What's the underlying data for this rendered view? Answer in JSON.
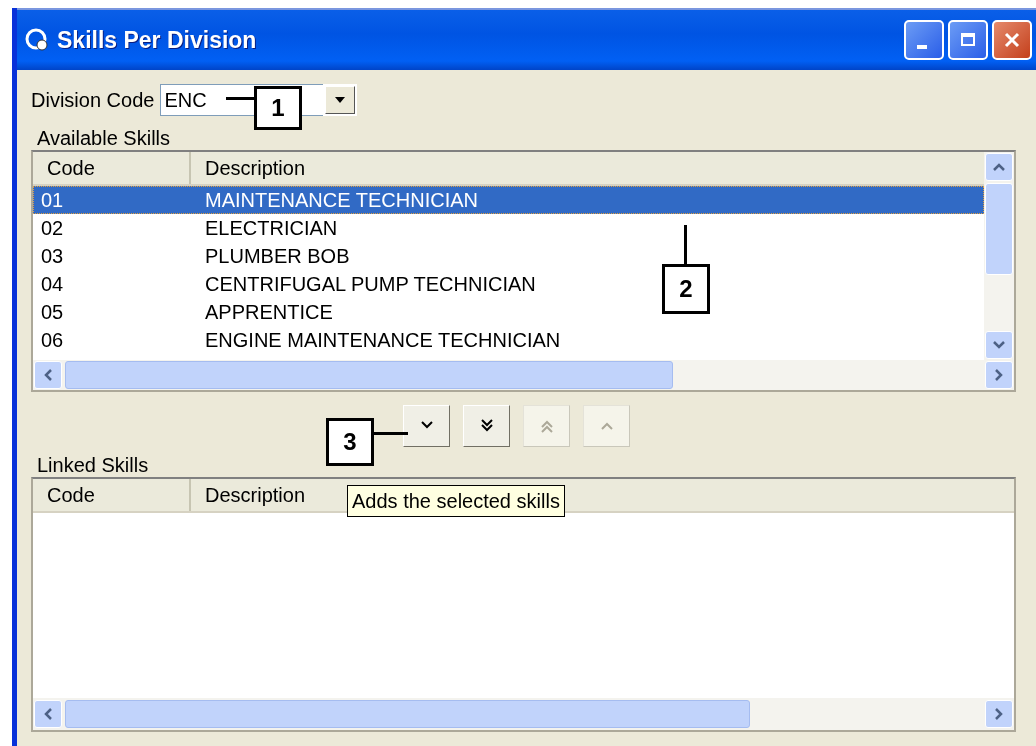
{
  "window": {
    "title": "Skills Per Division"
  },
  "division_code": {
    "label": "Division Code",
    "value": "ENC"
  },
  "available_skills": {
    "label": "Available Skills",
    "columns": [
      "Code",
      "Description"
    ],
    "rows": [
      {
        "code": "01",
        "description": "MAINTENANCE TECHNICIAN",
        "selected": true
      },
      {
        "code": "02",
        "description": "ELECTRICIAN",
        "selected": false
      },
      {
        "code": "03",
        "description": "PLUMBER BOB",
        "selected": false
      },
      {
        "code": "04",
        "description": "CENTRIFUGAL PUMP TECHNICIAN",
        "selected": false
      },
      {
        "code": "05",
        "description": "APPRENTICE",
        "selected": false
      },
      {
        "code": "06",
        "description": "ENGINE MAINTENANCE TECHNICIAN",
        "selected": false
      }
    ]
  },
  "transfer_buttons": [
    {
      "kind": "add",
      "disabled": false
    },
    {
      "kind": "add_all",
      "disabled": false
    },
    {
      "kind": "remove_all",
      "disabled": true
    },
    {
      "kind": "remove",
      "disabled": true
    }
  ],
  "tooltip": "Adds the selected skills",
  "linked_skills": {
    "label": "Linked Skills",
    "columns": [
      "Code",
      "Description"
    ]
  },
  "callouts": [
    {
      "number": "1"
    },
    {
      "number": "2"
    },
    {
      "number": "3"
    }
  ]
}
